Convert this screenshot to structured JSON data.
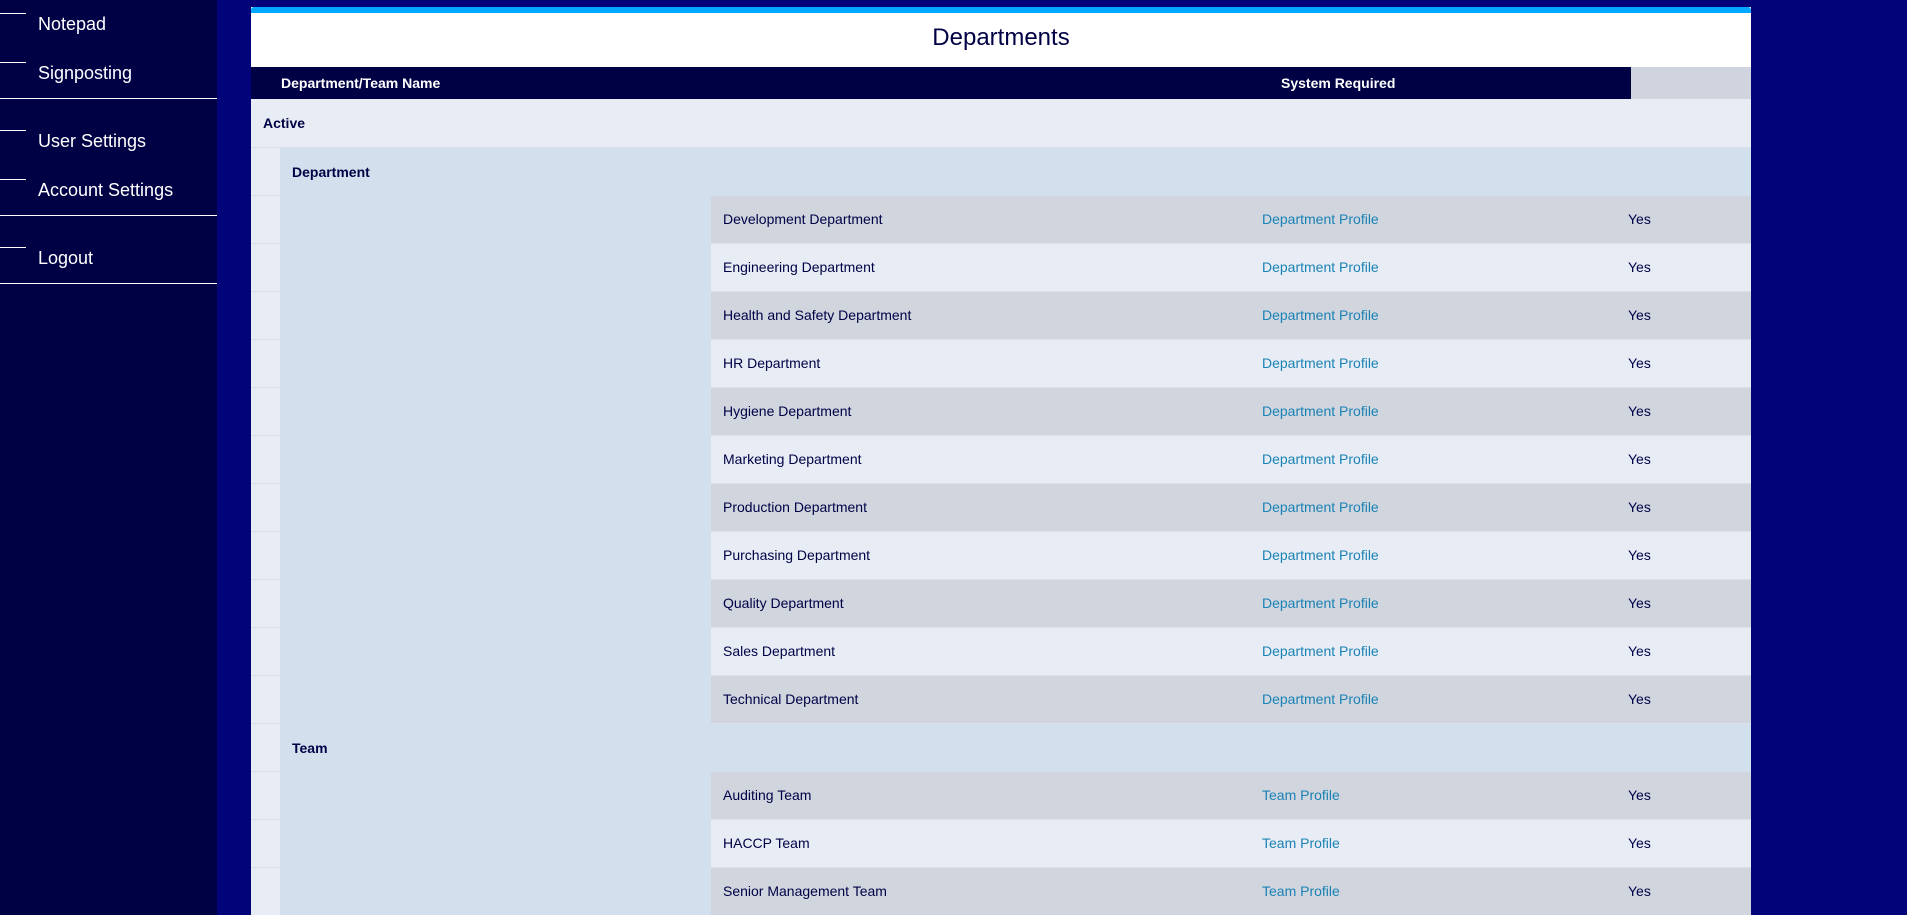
{
  "sidebar": {
    "groups": [
      {
        "items": [
          {
            "label": "Notepad"
          },
          {
            "label": "Signposting"
          }
        ]
      },
      {
        "items": [
          {
            "label": "User Settings"
          },
          {
            "label": "Account Settings"
          }
        ]
      },
      {
        "items": [
          {
            "label": "Logout"
          }
        ]
      }
    ]
  },
  "panel": {
    "title": "Departments",
    "columns": {
      "name": "Department/Team Name",
      "system_required": "System Required"
    },
    "status_group": "Active",
    "groups": [
      {
        "label": "Department",
        "rows": [
          {
            "name": "Development Department",
            "link": "Department Profile",
            "required": "Yes"
          },
          {
            "name": "Engineering Department",
            "link": "Department Profile",
            "required": "Yes"
          },
          {
            "name": "Health and Safety Department",
            "link": "Department Profile",
            "required": "Yes"
          },
          {
            "name": "HR Department",
            "link": "Department Profile",
            "required": "Yes"
          },
          {
            "name": "Hygiene Department",
            "link": "Department Profile",
            "required": "Yes"
          },
          {
            "name": "Marketing Department",
            "link": "Department Profile",
            "required": "Yes"
          },
          {
            "name": "Production Department",
            "link": "Department Profile",
            "required": "Yes"
          },
          {
            "name": "Purchasing Department",
            "link": "Department Profile",
            "required": "Yes"
          },
          {
            "name": "Quality Department",
            "link": "Department Profile",
            "required": "Yes"
          },
          {
            "name": "Sales Department",
            "link": "Department Profile",
            "required": "Yes"
          },
          {
            "name": "Technical Department",
            "link": "Department Profile",
            "required": "Yes"
          }
        ]
      },
      {
        "label": "Team",
        "rows": [
          {
            "name": "Auditing Team",
            "link": "Team Profile",
            "required": "Yes"
          },
          {
            "name": "HACCP Team",
            "link": "Team Profile",
            "required": "Yes"
          },
          {
            "name": "Senior Management Team",
            "link": "Team Profile",
            "required": "Yes"
          }
        ]
      }
    ]
  },
  "colors": {
    "background": "#020279",
    "sidebar": "#000045",
    "accent": "#00a8ff",
    "header": "#000045",
    "link": "#1a82b4"
  }
}
